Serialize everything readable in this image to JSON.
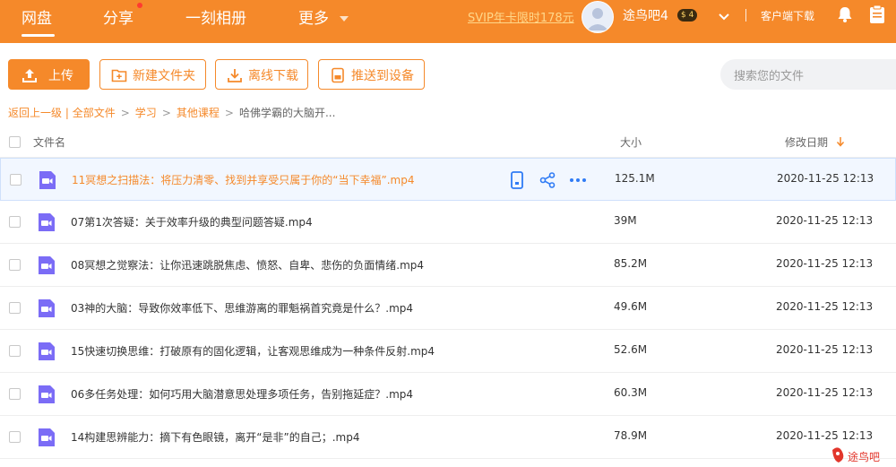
{
  "nav": {
    "items": [
      "网盘",
      "分享",
      "一刻相册",
      "更多"
    ],
    "svip_promo": "SVIP年卡限时178元",
    "username": "途鸟吧4",
    "vip_level": "$ 4",
    "client_download": "客户端下载"
  },
  "toolbar": {
    "upload": "上传",
    "new_folder": "新建文件夹",
    "offline_download": "离线下载",
    "push_to_device": "推送到设备",
    "search_placeholder": "搜索您的文件"
  },
  "breadcrumb": {
    "back": "返回上一级",
    "separator": "|",
    "items": [
      "全部文件",
      "学习",
      "其他课程",
      "哈佛学霸的大脑开..."
    ]
  },
  "table": {
    "headers": {
      "name": "文件名",
      "size": "大小",
      "date": "修改日期"
    },
    "rows": [
      {
        "name": "11冥想之扫描法：将压力清零、找到并享受只属于你的“当下幸福”.mp4",
        "size": "125.1M",
        "date": "2020-11-25 12:13"
      },
      {
        "name": "07第1次答疑：关于效率升级的典型问题答疑.mp4",
        "size": "39M",
        "date": "2020-11-25 12:13"
      },
      {
        "name": "08冥想之觉察法：让你迅速跳脱焦虑、愤怒、自卑、悲伤的负面情绪.mp4",
        "size": "85.2M",
        "date": "2020-11-25 12:13"
      },
      {
        "name": "03神的大脑：导致你效率低下、思维游离的罪魁祸首究竟是什么？.mp4",
        "size": "49.6M",
        "date": "2020-11-25 12:13"
      },
      {
        "name": "15快速切换思维：打破原有的固化逻辑，让客观思维成为一种条件反射.mp4",
        "size": "52.6M",
        "date": "2020-11-25 12:13"
      },
      {
        "name": "06多任务处理：如何巧用大脑潜意思处理多项任务，告别拖延症？.mp4",
        "size": "60.3M",
        "date": "2020-11-25 12:13"
      },
      {
        "name": "14构建思辨能力：摘下有色眼镜，离开“是非”的自己；.mp4",
        "size": "78.9M",
        "date": "2020-11-25 12:13"
      }
    ]
  },
  "icons": {
    "row_actions": [
      "phone-icon",
      "share-icon",
      "more-icon"
    ],
    "file": "video-file-icon"
  },
  "colors": {
    "accent": "#f5892a",
    "file_icon": "#7b6cf6",
    "hover_row": "#f2f7ff"
  },
  "watermark": "途鸟吧"
}
